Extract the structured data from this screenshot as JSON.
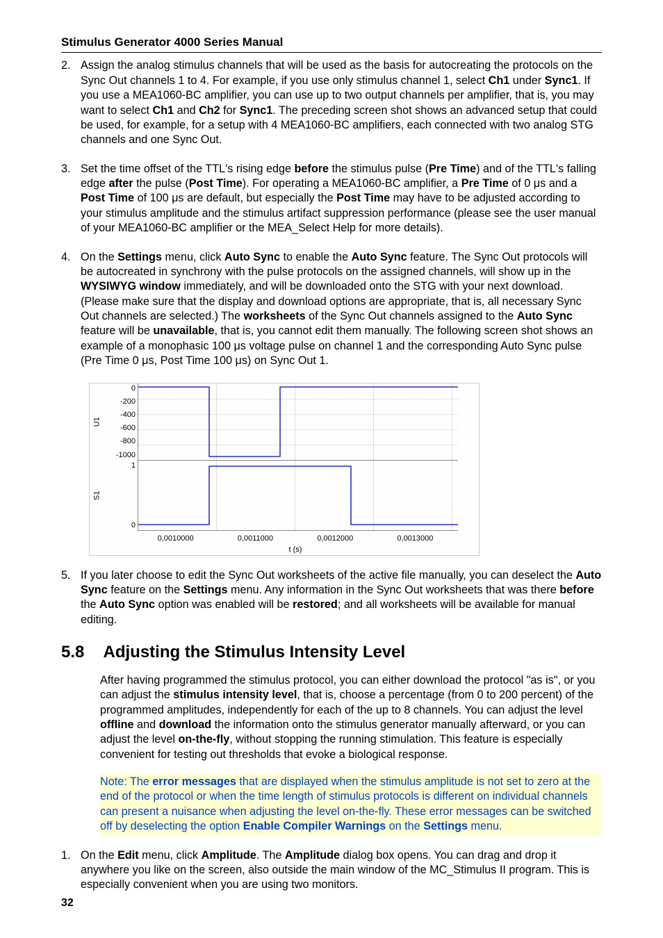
{
  "header": {
    "title": "Stimulus Generator 4000 Series Manual"
  },
  "list_top": [
    {
      "num": "2.",
      "html": "Assign the analog stimulus channels that will be used as the basis for autocreating the protocols on the Sync Out channels 1 to 4. For example, if you use only stimulus channel 1, select <b>Ch1</b> under <b>Sync1</b>. If you use a MEA1060-BC amplifier, you can use up to two output channels per amplifier, that is, you may want to select <b>Ch1</b> and <b>Ch2</b> for <b>Sync1</b>. The preceding screen shot shows an advanced setup that could be used, for example, for a setup with 4 MEA1060-BC amplifiers, each connected with two analog STG channels and one Sync Out."
    },
    {
      "num": "3.",
      "html": "Set the time offset of the TTL's rising edge <b>before</b> the stimulus pulse (<b>Pre Time</b>) and of the TTL's falling edge <b>after</b> the pulse (<b>Post Time</b>). For operating a MEA1060-BC amplifier, a <b>Pre Time</b> of 0 μs and a <b>Post Time</b> of 100 μs are default, but especially the <b>Post Time</b> may have to be adjusted according to your stimulus amplitude and the stimulus artifact suppression performance (please see the user manual of your MEA1060-BC amplifier or the MEA_Select Help for more details)."
    },
    {
      "num": "4.",
      "html": "On the <b>Settings</b> menu, click <b>Auto Sync</b> to enable the <b>Auto Sync</b> feature. The Sync Out protocols will be autocreated in synchrony with the pulse protocols on the assigned channels, will show up in the <b>WYSIWYG window</b> immediately, and will be downloaded onto the STG with your next download. (Please make sure that the display and download options are appropriate, that is, all necessary Sync Out channels are selected.) The <b>worksheets</b> of the Sync Out channels assigned to the <b>Auto Sync</b> feature will be <b>unavailable</b>, that is, you cannot edit them manually. The following screen shot shows an example of a monophasic 100 μs voltage pulse on channel 1 and the corresponding Auto Sync pulse (Pre Time 0 μs, Post Time 100 μs) on Sync Out 1."
    }
  ],
  "list_after_chart": [
    {
      "num": "5.",
      "html": "If you later choose to edit the Sync Out worksheets of the active file manually, you can deselect the <b>Auto Sync</b> feature on the <b>Settings</b> menu. Any information in the Sync Out worksheets that was there <b>before</b> the <b>Auto Sync</b> option was enabled will be <b>restored</b>; and all worksheets will be available for manual editing."
    }
  ],
  "section": {
    "num": "5.8",
    "title": "Adjusting the Stimulus Intensity Level",
    "body_html": "After having programmed the stimulus protocol, you can either download the protocol \"as is\", or you can adjust the <b>stimulus intensity level</b>, that is, choose a percentage (from 0 to 200 percent) of the programmed amplitudes, independently for each of the up to 8 channels. You can adjust the level <b>offline</b> and <b>download</b> the information onto the stimulus generator manually afterward, or you can adjust the level <b>on-the-fly</b>, without stopping the running stimulation. This feature is especially convenient for testing out thresholds that evoke a biological response.",
    "note_html": "Note: The <b>error messages</b> that are displayed when the stimulus amplitude is not set to zero at the end of the protocol or when the time length of stimulus protocols is different on individual channels can present a nuisance when adjusting the level on-the-fly. These error messages can be switched off by deselecting the option <b>Enable Compiler Warnings</b> on the <b>Settings</b> menu."
  },
  "list_bottom": [
    {
      "num": "1.",
      "html": "On the <b>Edit</b> menu, click <b>Amplitude</b>. The <b>Amplitude</b> dialog box opens. You can drag and drop it anywhere you like on the screen, also outside the main window of the MC_Stimulus II program. This is especially convenient when you are using two monitors."
    }
  ],
  "chart_data": {
    "type": "line",
    "panels": [
      {
        "name": "U1",
        "ylim": [
          -1000,
          0
        ],
        "yticks": [
          0,
          -200,
          -400,
          -600,
          -800,
          -1000
        ],
        "series": [
          {
            "x": [
              0.0009,
              0.001,
              0.001,
              0.0011,
              0.0011,
              0.00135
            ],
            "y": [
              0,
              0,
              -1000,
              -1000,
              0,
              0
            ]
          }
        ]
      },
      {
        "name": "S1",
        "ylim": [
          0,
          1
        ],
        "yticks": [
          1,
          0
        ],
        "series": [
          {
            "x": [
              0.0009,
              0.001,
              0.001,
              0.0012,
              0.0012,
              0.00135
            ],
            "y": [
              0,
              0,
              1,
              1,
              0,
              0
            ]
          }
        ]
      }
    ],
    "xticks": [
      "0,0010000",
      "0,0011000",
      "0,0012000",
      "0,0013000"
    ],
    "xlabel": "t (s)"
  },
  "page_number": "32"
}
